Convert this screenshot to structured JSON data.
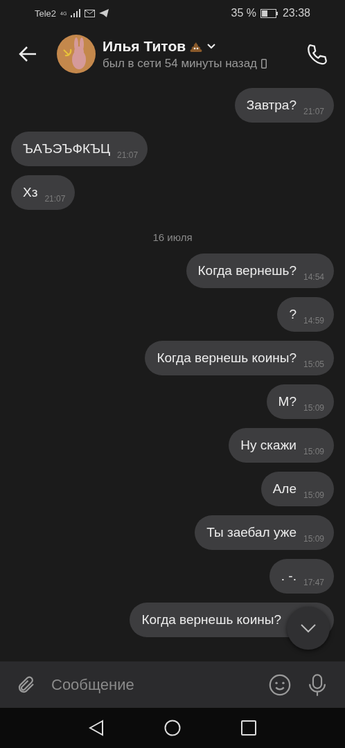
{
  "status_bar": {
    "carrier": "Tele2",
    "network": "4G",
    "battery": "35 %",
    "time": "23:38"
  },
  "header": {
    "name": "Илья Титов",
    "status": "был в сети 54 минуты назад"
  },
  "messages": [
    {
      "kind": "message",
      "outgoing": true,
      "text": "Завтра?",
      "time": "21:07"
    },
    {
      "kind": "message",
      "outgoing": false,
      "text": "ЪАЪЭЪФКЪЦ",
      "time": "21:07"
    },
    {
      "kind": "message",
      "outgoing": false,
      "text": "Хз",
      "time": "21:07"
    },
    {
      "kind": "date",
      "text": "16 июля"
    },
    {
      "kind": "message",
      "outgoing": true,
      "text": "Когда вернешь?",
      "time": "14:54"
    },
    {
      "kind": "message",
      "outgoing": true,
      "text": "?",
      "time": "14:59"
    },
    {
      "kind": "message",
      "outgoing": true,
      "text": "Когда вернешь коины?",
      "time": "15:05"
    },
    {
      "kind": "message",
      "outgoing": true,
      "text": "М?",
      "time": "15:09"
    },
    {
      "kind": "message",
      "outgoing": true,
      "text": "Ну скажи",
      "time": "15:09"
    },
    {
      "kind": "message",
      "outgoing": true,
      "text": "Але",
      "time": "15:09"
    },
    {
      "kind": "message",
      "outgoing": true,
      "text": "Ты заебал уже",
      "time": "15:09"
    },
    {
      "kind": "message",
      "outgoing": true,
      "text": ". -.",
      "time": "17:47"
    },
    {
      "kind": "message",
      "outgoing": true,
      "text": "Когда вернешь коины?"
    }
  ],
  "composer": {
    "placeholder": "Сообщение"
  }
}
